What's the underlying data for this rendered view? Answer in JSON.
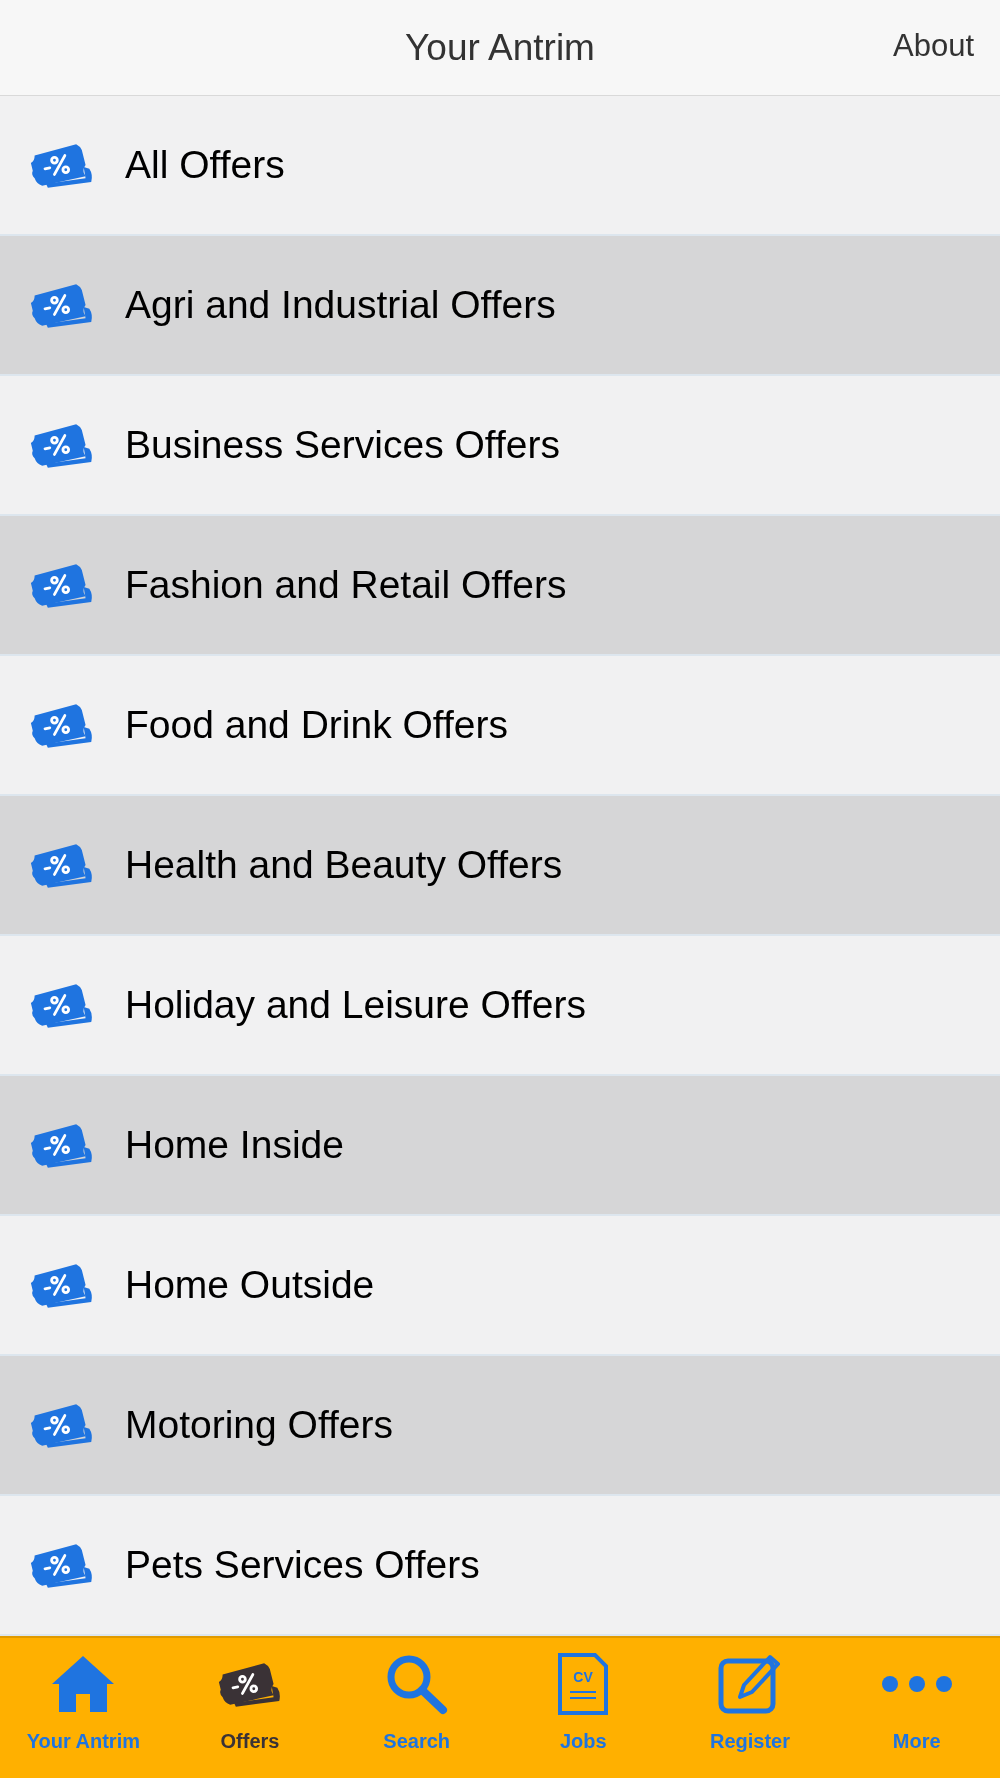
{
  "header": {
    "title": "Your Antrim",
    "action": "About"
  },
  "categories": [
    {
      "label": "All Offers"
    },
    {
      "label": "Agri and Industrial Offers"
    },
    {
      "label": "Business Services Offers"
    },
    {
      "label": "Fashion and Retail Offers"
    },
    {
      "label": "Food and Drink Offers"
    },
    {
      "label": "Health and Beauty Offers"
    },
    {
      "label": "Holiday and Leisure Offers"
    },
    {
      "label": "Home Inside"
    },
    {
      "label": "Home Outside"
    },
    {
      "label": "Motoring Offers"
    },
    {
      "label": "Pets Services Offers"
    }
  ],
  "tab_bar": [
    {
      "label": "Your Antrim",
      "kind": "home",
      "selected": false
    },
    {
      "label": "Offers",
      "kind": "offers",
      "selected": true
    },
    {
      "label": "Search",
      "kind": "search",
      "selected": false
    },
    {
      "label": "Jobs",
      "kind": "cv",
      "icon_text": "CV",
      "selected": false
    },
    {
      "label": "Register",
      "kind": "register",
      "selected": false
    },
    {
      "label": "More",
      "kind": "more",
      "selected": false
    }
  ]
}
